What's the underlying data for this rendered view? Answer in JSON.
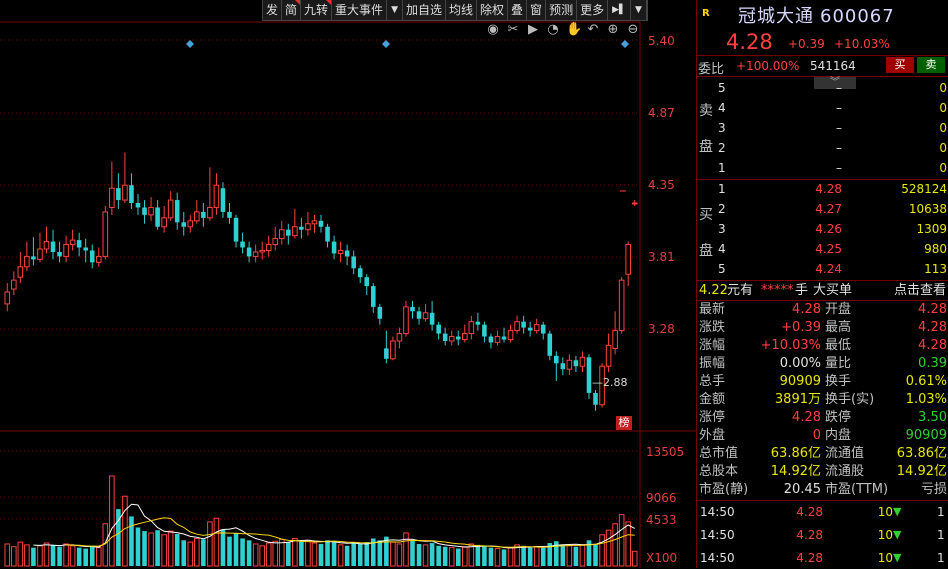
{
  "toolbar": {
    "items": [
      "发",
      "简",
      "九转",
      "重大事件",
      "加自选",
      "均线",
      "除权",
      "叠",
      "窗",
      "预测",
      "更多"
    ]
  },
  "price_axis": [
    "5.40",
    "4.87",
    "4.35",
    "3.81",
    "3.28"
  ],
  "volume_axis": [
    "13505",
    "9066",
    "4533"
  ],
  "volume_unit": "X100",
  "chart_low_label": "2.88",
  "bang_label": "榜",
  "stock": {
    "badge": "R",
    "name": "冠城大通",
    "code": "600067",
    "price": "4.28",
    "change": "+0.39",
    "change_pct": "+10.03%"
  },
  "weibi": {
    "label": "委比",
    "pct": "+100.00%",
    "value": "541164",
    "buy_label": "买",
    "sell_label": "卖"
  },
  "collapse_label": "︾",
  "sell_side_label": [
    "卖",
    "盘"
  ],
  "buy_side_label": [
    "买",
    "盘"
  ],
  "sell_orders": [
    {
      "level": "5",
      "price": "–",
      "vol": "0"
    },
    {
      "level": "4",
      "price": "–",
      "vol": "0"
    },
    {
      "level": "3",
      "price": "–",
      "vol": "0"
    },
    {
      "level": "2",
      "price": "–",
      "vol": "0"
    },
    {
      "level": "1",
      "price": "–",
      "vol": "0"
    }
  ],
  "buy_orders": [
    {
      "level": "1",
      "price": "4.28",
      "vol": "528124"
    },
    {
      "level": "2",
      "price": "4.27",
      "vol": "10638"
    },
    {
      "level": "3",
      "price": "4.26",
      "vol": "1309"
    },
    {
      "level": "4",
      "price": "4.25",
      "vol": "980"
    },
    {
      "level": "5",
      "price": "4.24",
      "vol": "113"
    }
  ],
  "strip": {
    "price": "4.22",
    "unit": "元有",
    "hidden": "*****",
    "hand": "手",
    "big_order": "大买单",
    "view": "点击查看"
  },
  "stats": [
    {
      "l1": "最新",
      "v1": "4.28",
      "c1": "red",
      "l2": "开盘",
      "v2": "4.28",
      "c2": "red"
    },
    {
      "l1": "涨跌",
      "v1": "+0.39",
      "c1": "red",
      "l2": "最高",
      "v2": "4.28",
      "c2": "red"
    },
    {
      "l1": "涨幅",
      "v1": "+10.03%",
      "c1": "red",
      "l2": "最低",
      "v2": "4.28",
      "c2": "red"
    },
    {
      "l1": "振幅",
      "v1": "0.00%",
      "c1": "white",
      "l2": "量比",
      "v2": "0.39",
      "c2": "green"
    },
    {
      "l1": "总手",
      "v1": "90909",
      "c1": "yellow",
      "l2": "换手",
      "v2": "0.61%",
      "c2": "yellow"
    },
    {
      "l1": "金额",
      "v1": "3891万",
      "c1": "yellow",
      "l2": "换手(实)",
      "v2": "1.03%",
      "c2": "yellow"
    },
    {
      "l1": "涨停",
      "v1": "4.28",
      "c1": "red",
      "l2": "跌停",
      "v2": "3.50",
      "c2": "green"
    },
    {
      "l1": "外盘",
      "v1": "0",
      "c1": "red",
      "l2": "内盘",
      "v2": "90909",
      "c2": "green"
    },
    {
      "l1": "总市值",
      "v1": "63.86亿",
      "c1": "yellow",
      "l2": "流通值",
      "v2": "63.86亿",
      "c2": "yellow"
    },
    {
      "l1": "总股本",
      "v1": "14.92亿",
      "c1": "yellow",
      "l2": "流通股",
      "v2": "14.92亿",
      "c2": "yellow"
    },
    {
      "l1": "市盈(静)",
      "v1": "20.45",
      "c1": "white",
      "l2": "市盈(TTM)",
      "v2": "亏损",
      "c2": "gray"
    }
  ],
  "ticks": [
    {
      "time": "14:50",
      "price": "4.28",
      "vol": "10",
      "dir": "▼",
      "flag": "1"
    },
    {
      "time": "14:50",
      "price": "4.28",
      "vol": "10",
      "dir": "▼",
      "flag": "1"
    },
    {
      "time": "14:50",
      "price": "4.28",
      "vol": "10",
      "dir": "▼",
      "flag": "1"
    }
  ],
  "colors": {
    "up": "#ff4040",
    "down": "#30d0d0",
    "ma5": "#ffffff",
    "ma10": "#ffd700",
    "grid": "#7a0000"
  },
  "chart_data": {
    "type": "candlestick",
    "price_range": [
      2.75,
      5.5
    ],
    "volume_max": 13505,
    "candles": [
      {
        "o": 3.6,
        "c": 3.68,
        "h": 3.74,
        "l": 3.55,
        "v": 2400
      },
      {
        "o": 3.7,
        "c": 3.76,
        "h": 3.82,
        "l": 3.66,
        "v": 2100
      },
      {
        "o": 3.78,
        "c": 3.85,
        "h": 3.95,
        "l": 3.74,
        "v": 2600
      },
      {
        "o": 3.85,
        "c": 3.92,
        "h": 4.02,
        "l": 3.82,
        "v": 2300
      },
      {
        "o": 3.92,
        "c": 3.9,
        "h": 4.05,
        "l": 3.86,
        "v": 2000
      },
      {
        "o": 3.9,
        "c": 3.97,
        "h": 4.08,
        "l": 3.88,
        "v": 2200
      },
      {
        "o": 3.97,
        "c": 4.02,
        "h": 4.12,
        "l": 3.94,
        "v": 2500
      },
      {
        "o": 4.02,
        "c": 3.95,
        "h": 4.1,
        "l": 3.9,
        "v": 2300
      },
      {
        "o": 3.95,
        "c": 3.92,
        "h": 4.02,
        "l": 3.88,
        "v": 2100
      },
      {
        "o": 3.92,
        "c": 4.0,
        "h": 4.06,
        "l": 3.88,
        "v": 2400
      },
      {
        "o": 4.0,
        "c": 4.03,
        "h": 4.1,
        "l": 3.96,
        "v": 2200
      },
      {
        "o": 4.03,
        "c": 3.98,
        "h": 4.08,
        "l": 3.92,
        "v": 2000
      },
      {
        "o": 3.98,
        "c": 3.96,
        "h": 4.04,
        "l": 3.88,
        "v": 1900
      },
      {
        "o": 3.96,
        "c": 3.88,
        "h": 4.0,
        "l": 3.84,
        "v": 2100
      },
      {
        "o": 3.88,
        "c": 3.92,
        "h": 3.98,
        "l": 3.85,
        "v": 2000
      },
      {
        "o": 3.92,
        "c": 4.22,
        "h": 4.26,
        "l": 3.9,
        "v": 4600
      },
      {
        "o": 4.25,
        "c": 4.38,
        "h": 4.56,
        "l": 4.2,
        "v": 9800
      },
      {
        "o": 4.38,
        "c": 4.3,
        "h": 4.48,
        "l": 4.24,
        "v": 6200
      },
      {
        "o": 4.3,
        "c": 4.4,
        "h": 4.62,
        "l": 4.28,
        "v": 7600
      },
      {
        "o": 4.4,
        "c": 4.28,
        "h": 4.48,
        "l": 4.24,
        "v": 5400
      },
      {
        "o": 4.28,
        "c": 4.25,
        "h": 4.34,
        "l": 4.2,
        "v": 4200
      },
      {
        "o": 4.25,
        "c": 4.2,
        "h": 4.3,
        "l": 4.14,
        "v": 3800
      },
      {
        "o": 4.2,
        "c": 4.25,
        "h": 4.32,
        "l": 4.16,
        "v": 3600
      },
      {
        "o": 4.25,
        "c": 4.12,
        "h": 4.3,
        "l": 4.1,
        "v": 3900
      },
      {
        "o": 4.12,
        "c": 4.18,
        "h": 4.26,
        "l": 4.08,
        "v": 3400
      },
      {
        "o": 4.18,
        "c": 4.3,
        "h": 4.36,
        "l": 4.16,
        "v": 3800
      },
      {
        "o": 4.3,
        "c": 4.15,
        "h": 4.35,
        "l": 4.1,
        "v": 3500
      },
      {
        "o": 4.15,
        "c": 4.12,
        "h": 4.22,
        "l": 4.06,
        "v": 2800
      },
      {
        "o": 4.12,
        "c": 4.16,
        "h": 4.2,
        "l": 4.08,
        "v": 2600
      },
      {
        "o": 4.16,
        "c": 4.22,
        "h": 4.3,
        "l": 4.14,
        "v": 3000
      },
      {
        "o": 4.22,
        "c": 4.18,
        "h": 4.28,
        "l": 4.12,
        "v": 2900
      },
      {
        "o": 4.18,
        "c": 4.25,
        "h": 4.52,
        "l": 4.16,
        "v": 4800
      },
      {
        "o": 4.25,
        "c": 4.4,
        "h": 4.48,
        "l": 4.2,
        "v": 5200
      },
      {
        "o": 4.38,
        "c": 4.22,
        "h": 4.42,
        "l": 4.18,
        "v": 4000
      },
      {
        "o": 4.22,
        "c": 4.18,
        "h": 4.28,
        "l": 4.14,
        "v": 3200
      },
      {
        "o": 4.18,
        "c": 4.02,
        "h": 4.2,
        "l": 3.98,
        "v": 3600
      },
      {
        "o": 4.02,
        "c": 3.98,
        "h": 4.08,
        "l": 3.94,
        "v": 3000
      },
      {
        "o": 3.98,
        "c": 3.92,
        "h": 4.02,
        "l": 3.88,
        "v": 2800
      },
      {
        "o": 3.92,
        "c": 3.95,
        "h": 4.0,
        "l": 3.88,
        "v": 2400
      },
      {
        "o": 3.95,
        "c": 3.96,
        "h": 4.02,
        "l": 3.9,
        "v": 2200
      },
      {
        "o": 3.96,
        "c": 4.0,
        "h": 4.06,
        "l": 3.92,
        "v": 2500
      },
      {
        "o": 4.0,
        "c": 4.04,
        "h": 4.12,
        "l": 3.96,
        "v": 2700
      },
      {
        "o": 4.04,
        "c": 4.1,
        "h": 4.16,
        "l": 4.0,
        "v": 2900
      },
      {
        "o": 4.1,
        "c": 4.06,
        "h": 4.14,
        "l": 4.0,
        "v": 2600
      },
      {
        "o": 4.06,
        "c": 4.12,
        "h": 4.24,
        "l": 4.04,
        "v": 3000
      },
      {
        "o": 4.12,
        "c": 4.1,
        "h": 4.18,
        "l": 4.04,
        "v": 2700
      },
      {
        "o": 4.1,
        "c": 4.14,
        "h": 4.22,
        "l": 4.06,
        "v": 2800
      },
      {
        "o": 4.14,
        "c": 4.16,
        "h": 4.2,
        "l": 4.08,
        "v": 2500
      },
      {
        "o": 4.16,
        "c": 4.12,
        "h": 4.2,
        "l": 4.08,
        "v": 2400
      },
      {
        "o": 4.12,
        "c": 4.02,
        "h": 4.14,
        "l": 3.98,
        "v": 2800
      },
      {
        "o": 4.02,
        "c": 3.94,
        "h": 4.06,
        "l": 3.9,
        "v": 2700
      },
      {
        "o": 3.94,
        "c": 3.96,
        "h": 4.02,
        "l": 3.88,
        "v": 2300
      },
      {
        "o": 3.96,
        "c": 3.92,
        "h": 4.0,
        "l": 3.86,
        "v": 2200
      },
      {
        "o": 3.92,
        "c": 3.84,
        "h": 3.96,
        "l": 3.8,
        "v": 2500
      },
      {
        "o": 3.84,
        "c": 3.78,
        "h": 3.86,
        "l": 3.74,
        "v": 2400
      },
      {
        "o": 3.78,
        "c": 3.72,
        "h": 3.8,
        "l": 3.66,
        "v": 2600
      },
      {
        "o": 3.72,
        "c": 3.58,
        "h": 3.74,
        "l": 3.54,
        "v": 3000
      },
      {
        "o": 3.58,
        "c": 3.5,
        "h": 3.6,
        "l": 3.46,
        "v": 2800
      },
      {
        "o": 3.3,
        "c": 3.23,
        "h": 3.42,
        "l": 3.2,
        "v": 3200
      },
      {
        "o": 3.23,
        "c": 3.35,
        "h": 3.38,
        "l": 3.22,
        "v": 2600
      },
      {
        "o": 3.35,
        "c": 3.4,
        "h": 3.44,
        "l": 3.3,
        "v": 2400
      },
      {
        "o": 3.4,
        "c": 3.58,
        "h": 3.62,
        "l": 3.38,
        "v": 3600
      },
      {
        "o": 3.58,
        "c": 3.55,
        "h": 3.62,
        "l": 3.5,
        "v": 2800
      },
      {
        "o": 3.55,
        "c": 3.5,
        "h": 3.58,
        "l": 3.46,
        "v": 2400
      },
      {
        "o": 3.5,
        "c": 3.54,
        "h": 3.6,
        "l": 3.48,
        "v": 2300
      },
      {
        "o": 3.54,
        "c": 3.46,
        "h": 3.62,
        "l": 3.42,
        "v": 2500
      },
      {
        "o": 3.46,
        "c": 3.4,
        "h": 3.48,
        "l": 3.36,
        "v": 2200
      },
      {
        "o": 3.4,
        "c": 3.35,
        "h": 3.44,
        "l": 3.32,
        "v": 2100
      },
      {
        "o": 3.35,
        "c": 3.38,
        "h": 3.42,
        "l": 3.32,
        "v": 2000
      },
      {
        "o": 3.38,
        "c": 3.36,
        "h": 3.42,
        "l": 3.32,
        "v": 1900
      },
      {
        "o": 3.36,
        "c": 3.4,
        "h": 3.46,
        "l": 3.34,
        "v": 2100
      },
      {
        "o": 3.4,
        "c": 3.48,
        "h": 3.52,
        "l": 3.36,
        "v": 2400
      },
      {
        "o": 3.48,
        "c": 3.46,
        "h": 3.54,
        "l": 3.42,
        "v": 2300
      },
      {
        "o": 3.46,
        "c": 3.38,
        "h": 3.48,
        "l": 3.34,
        "v": 2100
      },
      {
        "o": 3.38,
        "c": 3.34,
        "h": 3.4,
        "l": 3.3,
        "v": 2000
      },
      {
        "o": 3.34,
        "c": 3.38,
        "h": 3.42,
        "l": 3.32,
        "v": 1900
      },
      {
        "o": 3.38,
        "c": 3.36,
        "h": 3.44,
        "l": 3.34,
        "v": 1800
      },
      {
        "o": 3.36,
        "c": 3.42,
        "h": 3.46,
        "l": 3.34,
        "v": 2000
      },
      {
        "o": 3.42,
        "c": 3.48,
        "h": 3.52,
        "l": 3.4,
        "v": 2300
      },
      {
        "o": 3.48,
        "c": 3.44,
        "h": 3.52,
        "l": 3.4,
        "v": 2200
      },
      {
        "o": 3.44,
        "c": 3.42,
        "h": 3.48,
        "l": 3.38,
        "v": 2000
      },
      {
        "o": 3.42,
        "c": 3.46,
        "h": 3.5,
        "l": 3.4,
        "v": 2100
      },
      {
        "o": 3.46,
        "c": 3.4,
        "h": 3.48,
        "l": 3.36,
        "v": 2000
      },
      {
        "o": 3.4,
        "c": 3.25,
        "h": 3.42,
        "l": 3.22,
        "v": 2500
      },
      {
        "o": 3.25,
        "c": 3.2,
        "h": 3.28,
        "l": 3.08,
        "v": 2700
      },
      {
        "o": 3.2,
        "c": 3.16,
        "h": 3.24,
        "l": 3.12,
        "v": 2300
      },
      {
        "o": 3.16,
        "c": 3.22,
        "h": 3.26,
        "l": 3.12,
        "v": 2200
      },
      {
        "o": 3.22,
        "c": 3.18,
        "h": 3.25,
        "l": 3.14,
        "v": 2100
      },
      {
        "o": 3.18,
        "c": 3.24,
        "h": 3.28,
        "l": 3.14,
        "v": 2300
      },
      {
        "o": 3.24,
        "c": 3.0,
        "h": 3.26,
        "l": 2.96,
        "v": 2800
      },
      {
        "o": 3.0,
        "c": 2.92,
        "h": 3.02,
        "l": 2.88,
        "v": 2400
      },
      {
        "o": 2.92,
        "c": 3.18,
        "h": 3.2,
        "l": 2.9,
        "v": 3400
      },
      {
        "o": 3.18,
        "c": 3.32,
        "h": 3.4,
        "l": 3.14,
        "v": 3900
      },
      {
        "o": 3.3,
        "c": 3.42,
        "h": 3.55,
        "l": 3.26,
        "v": 4600
      },
      {
        "o": 3.42,
        "c": 3.76,
        "h": 3.78,
        "l": 3.4,
        "v": 5600
      },
      {
        "o": 3.8,
        "c": 4.0,
        "h": 4.02,
        "l": 3.72,
        "v": 4800
      },
      {
        "o": 4.28,
        "c": 4.28,
        "h": 4.3,
        "l": 4.26,
        "v": 1600
      }
    ]
  }
}
